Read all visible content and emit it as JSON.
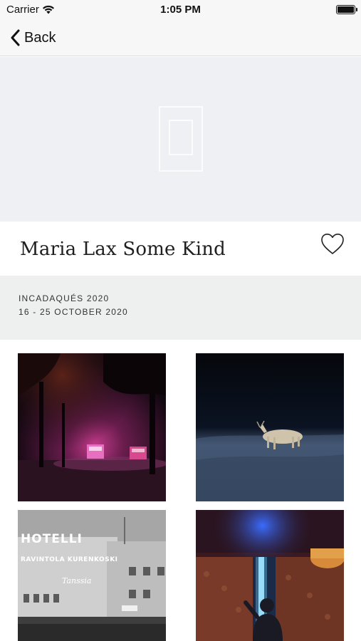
{
  "status_bar": {
    "carrier": "Carrier",
    "time": "1:05 PM"
  },
  "nav": {
    "back_label": "Back"
  },
  "event": {
    "title": "Maria Lax Some Kind",
    "festival": "INCADAQUÉS 2020",
    "dates": "16 - 25 OCTOBER 2020"
  },
  "gallery": {
    "photos": [
      {
        "name": "night-forest-lights-photo"
      },
      {
        "name": "reindeer-at-night-photo"
      },
      {
        "name": "hotelli-building-photo"
      },
      {
        "name": "figure-at-window-photo"
      }
    ]
  },
  "colors": {
    "hero_bg": "#eff0f4",
    "info_band_bg": "#eef0ef",
    "bar_bg": "#f7f7f7"
  }
}
